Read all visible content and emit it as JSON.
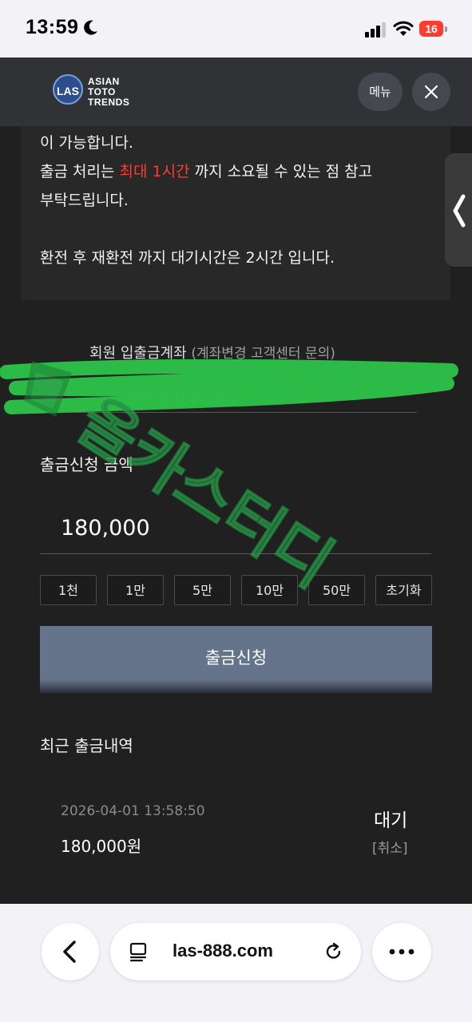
{
  "status_bar": {
    "time": "13:59",
    "battery": "16"
  },
  "header": {
    "logo_badge": "LAS",
    "logo_lines": [
      "ASIAN",
      "TOTO",
      "TRENDS"
    ],
    "menu_label": "메뉴"
  },
  "notice": {
    "line1": "이 가능합니다.",
    "line2_pre": "출금 처리는 ",
    "line2_red": "최대 1시간",
    "line2_post": " 까지 소요될 수 있는 점 참고",
    "line3": "부탁드립니다.",
    "line4": "환전 후 재환전 까지 대기시간은 2시간 입니다."
  },
  "account": {
    "label": "회원 입출금계좌",
    "sub_label": "(계좌변경 고객센터 문의)",
    "number_fragment": "00000 10472 2 7"
  },
  "withdraw": {
    "amount_label": "출금신청 금액",
    "amount_value": "180,000",
    "quick_buttons": [
      "1천",
      "1만",
      "5만",
      "10만",
      "50만",
      "초기화"
    ],
    "submit_label": "출금신청"
  },
  "history": {
    "title": "최근 출금내역",
    "items": [
      {
        "date": "2026-04-01 13:58:50",
        "amount": "180,000원",
        "status": "대기",
        "cancel": "[취소]"
      }
    ]
  },
  "browser": {
    "url": "las-888.com"
  },
  "watermark": {
    "text": "올카스터디"
  },
  "colors": {
    "accent_red": "#ff3b2e",
    "submit_bg": "#65748a",
    "scribble_green": "#2ec44a",
    "watermark_green": "#1f7a3a"
  }
}
